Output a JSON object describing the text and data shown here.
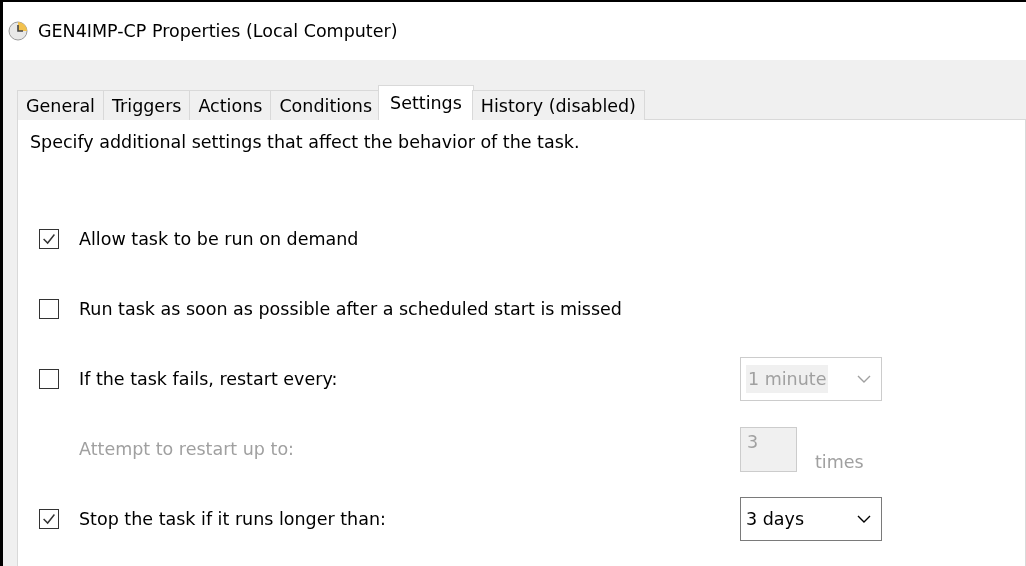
{
  "window": {
    "title": "GEN4IMP-CP Properties (Local Computer)"
  },
  "tabs": [
    {
      "label": "General",
      "selected": false
    },
    {
      "label": "Triggers",
      "selected": false
    },
    {
      "label": "Actions",
      "selected": false
    },
    {
      "label": "Conditions",
      "selected": false
    },
    {
      "label": "Settings",
      "selected": true
    },
    {
      "label": "History (disabled)",
      "selected": false
    }
  ],
  "description": "Specify additional settings that affect the behavior of the task.",
  "settings": [
    {
      "kind": "checkbox",
      "label": "Allow task to be run on demand",
      "checked": true
    },
    {
      "kind": "checkbox",
      "label": "Run task as soon as possible after a scheduled start is missed",
      "checked": false
    },
    {
      "kind": "checkbox-dropdown",
      "label": "If the task fails, restart every:",
      "checked": false,
      "value": "1 minute",
      "disabled": true
    },
    {
      "kind": "number",
      "label": "Attempt to restart up to:",
      "value": "3",
      "unit": "times",
      "disabled": true
    },
    {
      "kind": "checkbox-dropdown",
      "label": "Stop the task if it runs longer than:",
      "checked": true,
      "value": "3 days",
      "disabled": false
    }
  ]
}
